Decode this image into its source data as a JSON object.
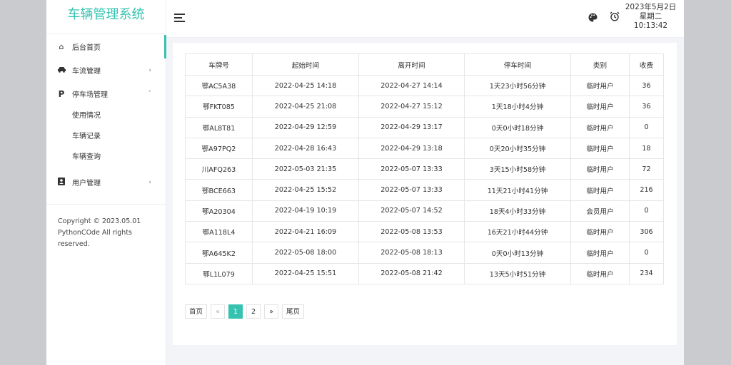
{
  "brand": "车辆管理系统",
  "sidebar": {
    "items": [
      {
        "label": "后台首页",
        "icon": "home-icon"
      },
      {
        "label": "车流管理",
        "icon": "car-icon"
      },
      {
        "label": "停车场管理",
        "icon": "parking-icon"
      },
      {
        "label": "用户管理",
        "icon": "user-card-icon"
      }
    ],
    "submenu": [
      "使用情况",
      "车辆记录",
      "车辆查询"
    ],
    "copyright": "Copyright © 2023.05.01 PythonCOde All rights reserved."
  },
  "header": {
    "date": "2023年5月2日",
    "weekday": "星期二",
    "time": "10:13:42"
  },
  "table": {
    "columns": [
      "车牌号",
      "起始时间",
      "离开时间",
      "停车时间",
      "类别",
      "收费"
    ],
    "rows": [
      [
        "鄂AC5A38",
        "2022-04-25 14:18",
        "2022-04-27 14:14",
        "1天23小时56分钟",
        "临时用户",
        "36"
      ],
      [
        "鄂FKT085",
        "2022-04-25 21:08",
        "2022-04-27 15:12",
        "1天18小时4分钟",
        "临时用户",
        "36"
      ],
      [
        "鄂AL8T81",
        "2022-04-29 12:59",
        "2022-04-29 13:17",
        "0天0小时18分钟",
        "临时用户",
        "0"
      ],
      [
        "鄂A97PQ2",
        "2022-04-28 16:43",
        "2022-04-29 13:18",
        "0天20小时35分钟",
        "临时用户",
        "18"
      ],
      [
        "川AFQ263",
        "2022-05-03 21:35",
        "2022-05-07 13:33",
        "3天15小时58分钟",
        "临时用户",
        "72"
      ],
      [
        "鄂BCE663",
        "2022-04-25 15:52",
        "2022-05-07 13:33",
        "11天21小时41分钟",
        "临时用户",
        "216"
      ],
      [
        "鄂A20304",
        "2022-04-19 10:19",
        "2022-05-07 14:52",
        "18天4小时33分钟",
        "会员用户",
        "0"
      ],
      [
        "鄂A118L4",
        "2022-04-21 16:09",
        "2022-05-08 13:53",
        "16天21小时44分钟",
        "临时用户",
        "306"
      ],
      [
        "鄂A645K2",
        "2022-05-08 18:00",
        "2022-05-08 18:13",
        "0天0小时13分钟",
        "临时用户",
        "0"
      ],
      [
        "鄂L1L079",
        "2022-04-25 15:51",
        "2022-05-08 21:42",
        "13天5小时51分钟",
        "临时用户",
        "234"
      ]
    ]
  },
  "pagination": {
    "first": "首页",
    "prev": "«",
    "pages": [
      "1",
      "2"
    ],
    "next": "»",
    "last": "尾页"
  },
  "colors": {
    "accent": "#35c3b0"
  }
}
